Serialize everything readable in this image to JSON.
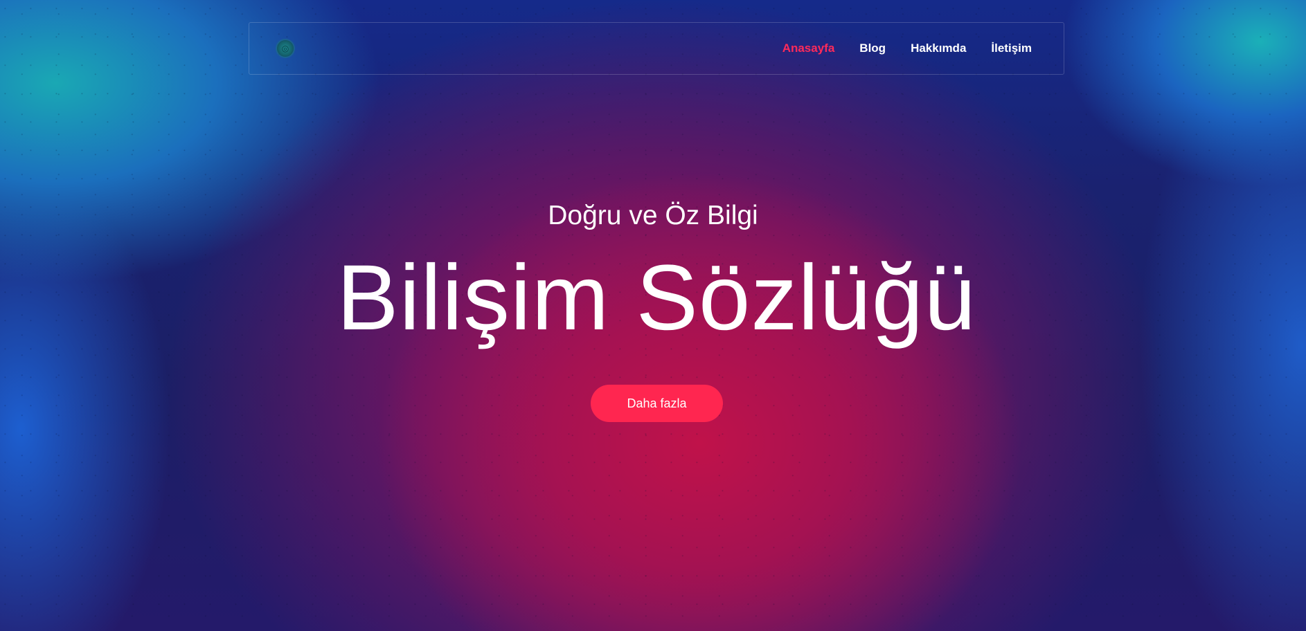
{
  "nav": {
    "logo_icon": "globe-icon",
    "items": [
      {
        "label": "Anasayfa",
        "active": true
      },
      {
        "label": "Blog",
        "active": false
      },
      {
        "label": "Hakkımda",
        "active": false
      },
      {
        "label": "İletişim",
        "active": false
      }
    ]
  },
  "hero": {
    "subtitle": "Doğru ve Öz Bilgi",
    "title": "Bilişim Sözlüğü",
    "cta_label": "Daha fazla"
  },
  "colors": {
    "accent": "#ff2650",
    "active_link": "#ff2a5a",
    "text": "#ffffff"
  }
}
